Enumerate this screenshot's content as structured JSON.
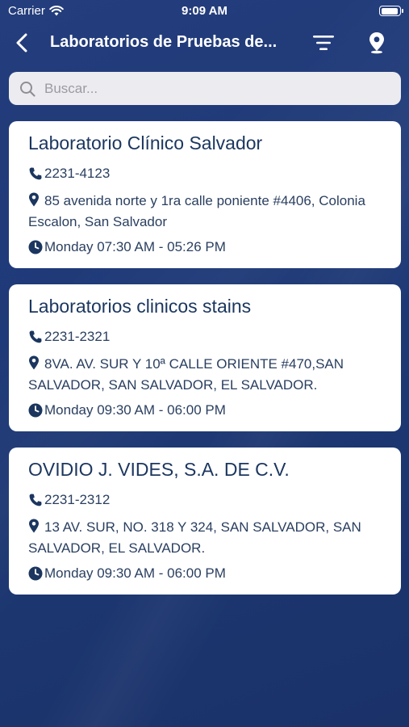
{
  "status_bar": {
    "carrier": "Carrier",
    "time": "9:09 AM"
  },
  "nav": {
    "title": "Laboratorios de Pruebas de..."
  },
  "search": {
    "placeholder": "Buscar..."
  },
  "labs": [
    {
      "name": "Laboratorio Clínico Salvador",
      "phone": "2231-4123",
      "address": "85 avenida norte y 1ra calle poniente #4406, Colonia Escalon, San Salvador",
      "hours": "Monday 07:30 AM - 05:26 PM"
    },
    {
      "name": "Laboratorios clinicos stains",
      "phone": "2231-2321",
      "address": "8VA. AV. SUR Y 10ª CALLE ORIENTE #470,SAN SALVADOR, SAN SALVADOR, EL SALVADOR.",
      "hours": "Monday 09:30 AM - 06:00 PM"
    },
    {
      "name": "OVIDIO J. VIDES, S.A. DE C.V.",
      "phone": "2231-2312",
      "address": "13 AV. SUR, NO. 318 Y 324, SAN SALVADOR, SAN SALVADOR, EL SALVADOR.",
      "hours": "Monday 09:30 AM - 06:00 PM"
    }
  ],
  "icons": {
    "back": "chevron-left-icon",
    "filter": "filter-icon",
    "map": "map-pin-icon",
    "search": "search-icon",
    "phone": "phone-icon",
    "address": "location-pin-icon",
    "hours": "clock-icon"
  },
  "colors": {
    "background": "#1f3a78",
    "card": "#ffffff",
    "card_text": "#1b365f",
    "search_bg": "#ececf0"
  }
}
